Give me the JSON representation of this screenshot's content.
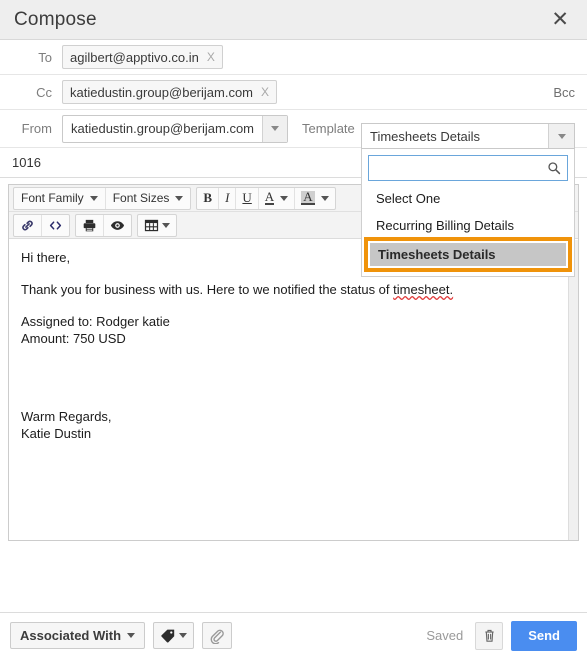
{
  "window": {
    "title": "Compose",
    "close_icon": "close-icon"
  },
  "fields": {
    "to": {
      "label": "To",
      "chip": "agilbert@apptivo.co.in",
      "chip_remove": "X"
    },
    "cc": {
      "label": "Cc",
      "chip": "katiedustin.group@berijam.com",
      "chip_remove": "X"
    },
    "bcc_link": "Bcc",
    "from": {
      "label": "From",
      "value": "katiedustin.group@berijam.com"
    },
    "template_label": "Template",
    "subject": "1016"
  },
  "template_dropdown": {
    "selected": "Timesheets Details",
    "search_value": "",
    "search_placeholder": "",
    "search_icon": "search-icon",
    "options": [
      {
        "label": "Select One",
        "selected": false
      },
      {
        "label": "Recurring Billing Details",
        "selected": false
      },
      {
        "label": "Timesheets Details",
        "selected": true
      }
    ],
    "highlight_color": "#f0930a",
    "selected_bg": "#c6c6c6",
    "search_border_color": "#6aa6db"
  },
  "toolbar": {
    "row1": [
      {
        "name": "font-family-select",
        "label": "Font Family",
        "caret": true
      },
      {
        "name": "font-sizes-select",
        "label": "Font Sizes",
        "caret": true
      }
    ],
    "format": [
      {
        "name": "bold-button",
        "label": "B"
      },
      {
        "name": "italic-button",
        "label": "I"
      },
      {
        "name": "underline-button",
        "label": "U"
      },
      {
        "name": "text-color-button",
        "label": "A",
        "caret": true
      },
      {
        "name": "highlight-color-button",
        "label": "A",
        "caret": true
      }
    ],
    "row2": [
      {
        "name": "insert-link-icon",
        "icon": "link-icon"
      },
      {
        "name": "source-code-icon",
        "icon": "code-icon"
      },
      {
        "name": "print-icon",
        "icon": "printer-icon"
      },
      {
        "name": "preview-icon",
        "icon": "eye-icon"
      },
      {
        "name": "insert-table-icon",
        "icon": "table-icon",
        "caret": true
      }
    ]
  },
  "body": {
    "greeting": "Hi there,",
    "paragraph_pre": "Thank you for business with us. Here to we notified the status of ",
    "paragraph_spell": "timesheet.",
    "assigned_to": " Assigned to: Rodger katie",
    "amount": "Amount: 750 USD",
    "sign_off": "Warm Regards,",
    "sign_name": "Katie  Dustin"
  },
  "footer": {
    "associated_with": "Associated With",
    "tag_icon": "tag-icon",
    "attach_icon": "paperclip-icon",
    "saved_status": "Saved",
    "delete_icon": "trash-icon",
    "send_label": "Send",
    "send_color": "#4a8df0"
  }
}
